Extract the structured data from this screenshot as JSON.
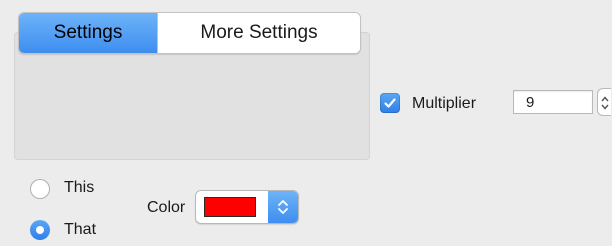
{
  "tabs": [
    {
      "label": "Settings",
      "selected": true
    },
    {
      "label": "More Settings",
      "selected": false
    }
  ],
  "multiplier": {
    "checked": true,
    "label": "Multiplier",
    "value": "9",
    "checkbox_icon": "checkmark-icon",
    "stepper_icon": "stepper-arrows-icon"
  },
  "radios": [
    {
      "label": "This",
      "selected": false
    },
    {
      "label": "That",
      "selected": true
    }
  ],
  "color": {
    "label": "Color",
    "value": "#ff0000",
    "popup_icon": "updown-arrows-icon"
  },
  "accent_color": "#3e8ef0"
}
